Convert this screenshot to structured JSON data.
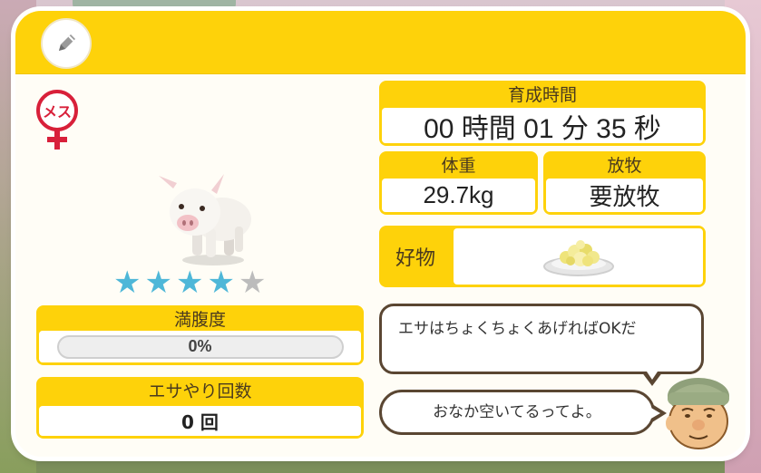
{
  "header": {
    "edit_icon": "pencil-icon"
  },
  "animal": {
    "gender_label": "メス",
    "gender_icon": "female-icon",
    "stars_filled": 4,
    "stars_total": 5
  },
  "satiety": {
    "label": "満腹度",
    "value": "0%",
    "fraction": 0
  },
  "feed_count": {
    "label": "エサやり回数",
    "value": "0 回"
  },
  "growth_time": {
    "label": "育成時間",
    "value": "00 時間 01 分 35 秒"
  },
  "weight": {
    "label": "体重",
    "value": "29.7kg"
  },
  "grazing": {
    "label": "放牧",
    "value": "要放牧"
  },
  "favorite": {
    "label": "好物",
    "icon": "feed-plate-icon"
  },
  "messages": [
    "エサはちょくちょくあげればOKだ",
    "おなか空いてるってよ。"
  ],
  "colors": {
    "accent": "#fed20a",
    "star_on": "#4eb7d8",
    "star_off": "#bcbcbc",
    "gender": "#d8203a"
  }
}
